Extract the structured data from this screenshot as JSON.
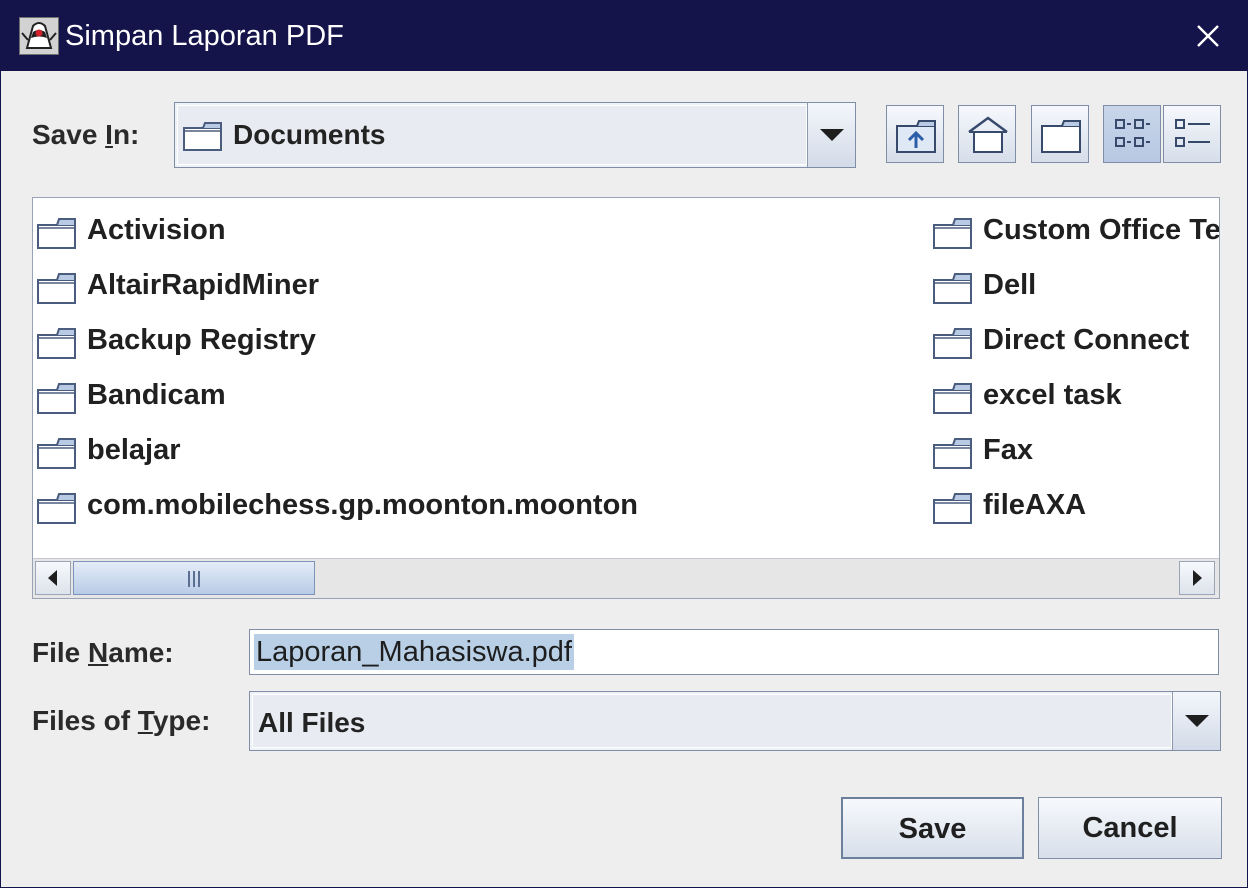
{
  "window": {
    "title": "Simpan Laporan PDF"
  },
  "save_in": {
    "label_pre": "Save ",
    "label_mnemonic": "I",
    "label_post": "n:",
    "value": "Documents"
  },
  "toolbar": {
    "up_folder": "up-folder-icon",
    "home": "home-icon",
    "new_folder": "new-folder-icon",
    "list_view": "list-view-icon",
    "details_view": "details-view-icon",
    "active_view": "list"
  },
  "files": {
    "column1": [
      "Activision",
      "AltairRapidMiner",
      "Backup Registry",
      "Bandicam",
      "belajar",
      "com.mobilechess.gp.moonton.moonton"
    ],
    "column2": [
      "Custom Office Te",
      "Dell",
      "Direct Connect",
      "excel task",
      "Fax",
      "fileAXA"
    ]
  },
  "file_name": {
    "label_pre": "File ",
    "label_mnemonic": "N",
    "label_post": "ame:",
    "value": "Laporan_Mahasiswa.pdf"
  },
  "file_type": {
    "label_pre": "Files of ",
    "label_mnemonic": "T",
    "label_post": "ype:",
    "value": "All Files"
  },
  "buttons": {
    "save": "Save",
    "cancel": "Cancel"
  },
  "colors": {
    "titlebar": "#14144a",
    "selection": "#b8cfe5",
    "background": "#eeeeee"
  }
}
